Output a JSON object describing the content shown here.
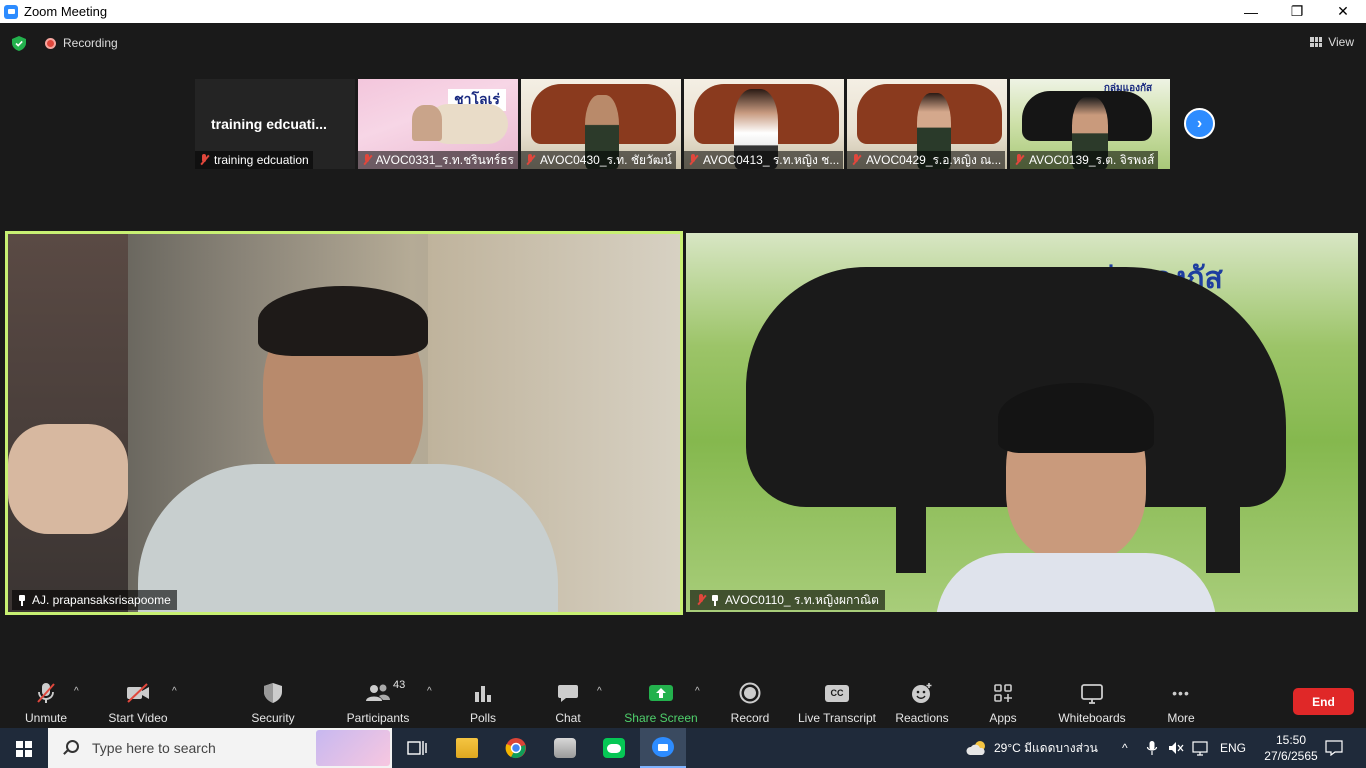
{
  "window": {
    "title": "Zoom Meeting",
    "minimize_glyph": "—",
    "maximize_glyph": "❐",
    "close_glyph": "✕"
  },
  "status": {
    "recording_label": "Recording",
    "view_label": "View"
  },
  "thumbnails": [
    {
      "display_name": "training  edcuati...",
      "label": "training edcuation",
      "muted": true
    },
    {
      "label": "AVOC0331_ร.ท.ชรินทร์ธร",
      "muted": true,
      "banner": "ชาโลเร่"
    },
    {
      "label": "AVOC0430_ร.ท. ชัยวัฒน์",
      "muted": true
    },
    {
      "label": "AVOC0413_ ร.ท.หญิง ช...",
      "muted": true
    },
    {
      "label": "AVOC0429_ร.อ.หญิง ณ...",
      "muted": true
    },
    {
      "label": "AVOC0139_ร.ต. จิรพงส์",
      "muted": true,
      "banner": "กลุ่มแองกัส"
    }
  ],
  "next_glyph": "›",
  "main_videos": {
    "left_label": "AJ. prapansaksrisapoome",
    "right_label": "AVOC0110_ ร.ท.หญิงผกาณิต",
    "right_banner": "กลุ่มแองกัส"
  },
  "toolbar": {
    "unmute": "Unmute",
    "start_video": "Start Video",
    "security": "Security",
    "participants": "Participants",
    "participants_count": "43",
    "polls": "Polls",
    "chat": "Chat",
    "share_screen": "Share Screen",
    "record": "Record",
    "live_transcript": "Live Transcript",
    "cc_glyph": "CC",
    "reactions": "Reactions",
    "apps": "Apps",
    "whiteboards": "Whiteboards",
    "more": "More",
    "more_glyph": "•••",
    "end": "End",
    "caret_glyph": "^"
  },
  "taskbar": {
    "search_placeholder": "Type here to search",
    "weather": "29°C  มีแดดบางส่วน",
    "language": "ENG",
    "time": "15:50",
    "date": "27/6/2565",
    "up_glyph": "^"
  },
  "colors": {
    "accent": "#2d8cff",
    "speaker_border": "#c8f073",
    "end": "#e02828",
    "share": "#23b14d",
    "mute_red": "#e0473c"
  }
}
